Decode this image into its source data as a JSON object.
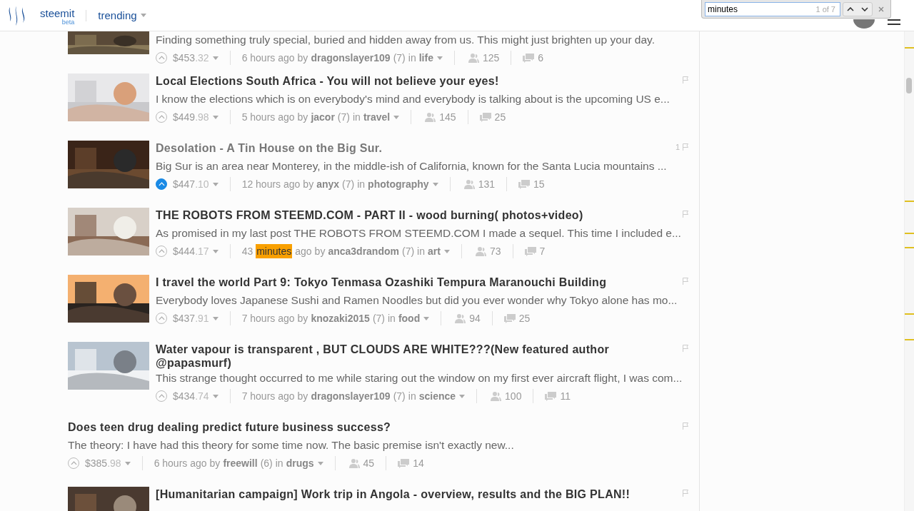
{
  "header": {
    "brand": "steemit",
    "brand_tag": "beta",
    "feed": "trending"
  },
  "find_bar": {
    "value": "minutes",
    "count": "1 of 7"
  },
  "posts": [
    {
      "thumb": true,
      "excerpt": "Finding something truly special, buried and hidden away from us. This might just brighten up your day.",
      "voted": false,
      "payout": "$453",
      "cents": ".32",
      "time": [
        {
          "text": "6 hours ago",
          "highlighted": false
        }
      ],
      "by": "by",
      "author": "dragonslayer109",
      "rep": "(7)",
      "in": "in",
      "category": "life",
      "voters": "125",
      "comments": "6"
    },
    {
      "thumb": true,
      "title": "Local Elections South Africa - You will not believe your eyes!",
      "visited": false,
      "excerpt": "I know the elections which is on everybody's mind and everybody is talking about is the upcoming US e...",
      "voted": false,
      "payout": "$449",
      "cents": ".98",
      "time": [
        {
          "text": "5 hours ago",
          "highlighted": false
        }
      ],
      "by": "by",
      "author": "jacor",
      "rep": "(7)",
      "in": "in",
      "category": "travel",
      "voters": "145",
      "comments": "25"
    },
    {
      "thumb": true,
      "title": "Desolation - A Tin House on the Big Sur.",
      "visited": true,
      "flags": "1",
      "excerpt": "Big Sur is an area near Monterey, in the middle-ish of California, known for the Santa Lucia mountains ...",
      "voted": true,
      "payout": "$447",
      "cents": ".10",
      "time": [
        {
          "text": "12 hours ago",
          "highlighted": false
        }
      ],
      "by": "by",
      "author": "anyx",
      "rep": "(7)",
      "in": "in",
      "category": "photography",
      "voters": "131",
      "comments": "15"
    },
    {
      "thumb": true,
      "title": "THE ROBOTS FROM STEEMD.COM - PART II - wood burning( photos+video)",
      "visited": false,
      "excerpt": "As promised in my last post THE ROBOTS FROM STEEMD.COM I made a sequel. This time I included e...",
      "voted": false,
      "payout": "$444",
      "cents": ".17",
      "time": [
        {
          "text": "43",
          "highlighted": false
        },
        {
          "text": "minutes",
          "highlighted": true
        },
        {
          "text": "ago",
          "highlighted": false
        }
      ],
      "by": "by",
      "author": "anca3drandom",
      "rep": "(7)",
      "in": "in",
      "category": "art",
      "voters": "73",
      "comments": "7"
    },
    {
      "thumb": true,
      "title": "I travel the world Part 9: Tokyo Tenmasa Ozashiki Tempura Maranouchi Building",
      "visited": false,
      "excerpt": "Everybody loves Japanese Sushi and Ramen Noodles but did you ever wonder why Tokyo alone has mo...",
      "voted": false,
      "payout": "$437",
      "cents": ".91",
      "time": [
        {
          "text": "7 hours ago",
          "highlighted": false
        }
      ],
      "by": "by",
      "author": "knozaki2015",
      "rep": "(7)",
      "in": "in",
      "category": "food",
      "voters": "94",
      "comments": "25"
    },
    {
      "thumb": true,
      "title": "Water vapour is transparent , BUT CLOUDS ARE WHITE???(New featured author @papasmurf)",
      "visited": false,
      "excerpt": "This strange thought occurred to me while staring out the window on my first ever aircraft flight, I was com...",
      "voted": false,
      "payout": "$434",
      "cents": ".74",
      "time": [
        {
          "text": "7 hours ago",
          "highlighted": false
        }
      ],
      "by": "by",
      "author": "dragonslayer109",
      "rep": "(7)",
      "in": "in",
      "category": "science",
      "voters": "100",
      "comments": "11"
    },
    {
      "thumb": false,
      "title": "Does teen drug dealing predict future business success?",
      "visited": false,
      "excerpt": "The theory: I have had this theory for some time now. The basic premise isn't exactly new...",
      "voted": false,
      "payout": "$385",
      "cents": ".98",
      "time": [
        {
          "text": "6 hours ago",
          "highlighted": false
        }
      ],
      "by": "by",
      "author": "freewill",
      "rep": "(6)",
      "in": "in",
      "category": "drugs",
      "voters": "45",
      "comments": "14"
    },
    {
      "thumb": true,
      "title": "[Humanitarian campaign] Work trip in Angola - overview, results and the BIG PLAN!!",
      "visited": false
    }
  ]
}
